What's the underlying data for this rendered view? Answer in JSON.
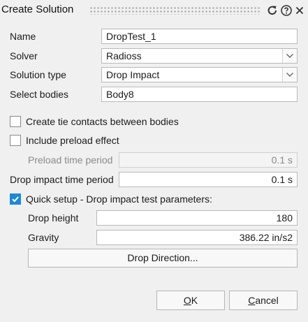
{
  "dialog": {
    "title": "Create Solution"
  },
  "fields": {
    "name": {
      "label": "Name",
      "value": "DropTest_1"
    },
    "solver": {
      "label": "Solver",
      "value": "Radioss"
    },
    "solution_type": {
      "label": "Solution type",
      "value": "Drop Impact"
    },
    "select_bodies": {
      "label": "Select bodies",
      "value": "Body8"
    }
  },
  "options": {
    "tie_contacts": {
      "label": "Create tie contacts between bodies",
      "checked": false
    },
    "preload": {
      "label": "Include preload effect",
      "checked": false
    },
    "preload_time": {
      "label": "Preload time period",
      "value": "0.1 s"
    },
    "drop_time": {
      "label": "Drop impact time period",
      "value": "0.1 s"
    },
    "quick_setup": {
      "label": "Quick setup - Drop impact test parameters:",
      "checked": true
    },
    "drop_height": {
      "label": "Drop height",
      "value": "180"
    },
    "gravity": {
      "label": "Gravity",
      "value": "386.22 in/s2"
    }
  },
  "buttons": {
    "drop_direction": "Drop Direction...",
    "ok": {
      "mnemonic": "O",
      "rest": "K"
    },
    "cancel": {
      "mnemonic": "C",
      "rest": "ancel"
    }
  },
  "icons": {
    "reset": "reset-icon",
    "help": "help-icon",
    "close": "close-icon",
    "dropdown": "chevron-down-icon",
    "check": "check-icon"
  },
  "colors": {
    "accent": "#1e88d6",
    "background": "#f0f0f0"
  }
}
